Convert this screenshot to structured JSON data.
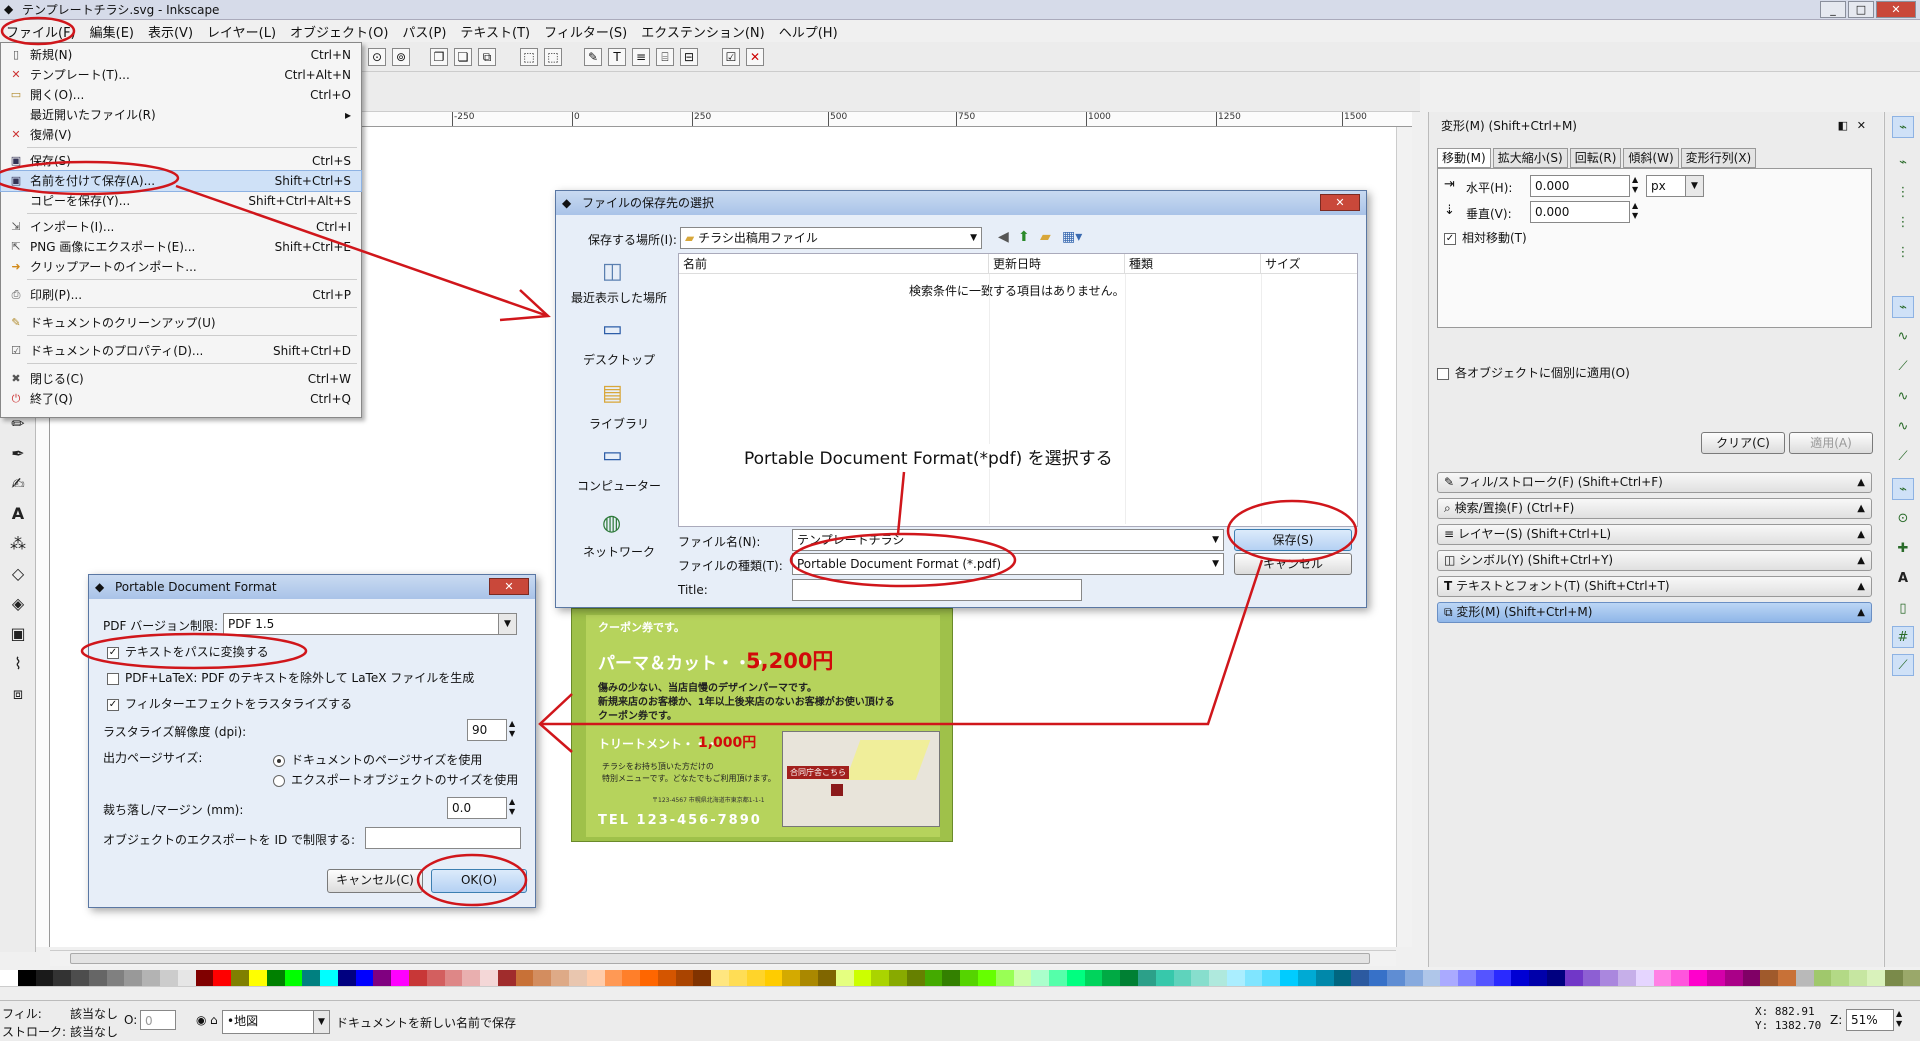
{
  "window": {
    "title": "テンプレートチラシ.svg - Inkscape",
    "min": "_",
    "max": "□",
    "close": "✕"
  },
  "menubar": [
    "ファイル(F)",
    "編集(E)",
    "表示(V)",
    "レイヤー(L)",
    "オブジェクト(O)",
    "パス(P)",
    "テキスト(T)",
    "フィルター(S)",
    "エクステンション(N)",
    "ヘルプ(H)"
  ],
  "file_menu": [
    {
      "label": "新規(N)",
      "shortcut": "Ctrl+N",
      "icon": "new-doc-icon"
    },
    {
      "label": "テンプレート(T)...",
      "shortcut": "Ctrl+Alt+N",
      "icon": "template-icon"
    },
    {
      "label": "開く(O)...",
      "shortcut": "Ctrl+O",
      "icon": "open-folder-icon"
    },
    {
      "label": "最近開いたファイル(R)",
      "shortcut": "▸",
      "icon": ""
    },
    {
      "label": "復帰(V)",
      "shortcut": "",
      "icon": "revert-icon"
    },
    {
      "label": "保存(S)",
      "shortcut": "Ctrl+S",
      "icon": "save-icon"
    },
    {
      "label": "名前を付けて保存(A)...",
      "shortcut": "Shift+Ctrl+S",
      "icon": "save-as-icon"
    },
    {
      "label": "コピーを保存(Y)...",
      "shortcut": "Shift+Ctrl+Alt+S",
      "icon": ""
    },
    {
      "label": "インポート(I)...",
      "shortcut": "Ctrl+I",
      "icon": "import-icon"
    },
    {
      "label": "PNG 画像にエクスポート(E)...",
      "shortcut": "Shift+Ctrl+E",
      "icon": "export-png-icon"
    },
    {
      "label": "クリップアートのインポート...",
      "shortcut": "",
      "icon": "clipart-icon"
    },
    {
      "label": "印刷(P)...",
      "shortcut": "Ctrl+P",
      "icon": "print-icon"
    },
    {
      "label": "ドキュメントのクリーンアップ(U)",
      "shortcut": "",
      "icon": "cleanup-icon"
    },
    {
      "label": "ドキュメントのプロパティ(D)...",
      "shortcut": "Shift+Ctrl+D",
      "icon": "doc-properties-icon"
    },
    {
      "label": "閉じる(C)",
      "shortcut": "Ctrl+W",
      "icon": "close-doc-icon"
    },
    {
      "label": "終了(Q)",
      "shortcut": "Ctrl+Q",
      "icon": "quit-icon"
    }
  ],
  "ruler_ticks": [
    "-250",
    "0",
    "250",
    "500",
    "750",
    "1000",
    "1250",
    "1500"
  ],
  "transform_panel": {
    "header": "変形(M) (Shift+Ctrl+M)",
    "tabs": [
      "移動(M)",
      "拡大縮小(S)",
      "回転(R)",
      "傾斜(W)",
      "変形行列(X)"
    ],
    "horizontal_label": "水平(H):",
    "horizontal_value": "0.000",
    "vertical_label": "垂直(V):",
    "vertical_value": "0.000",
    "unit": "px",
    "relative_move": "相対移動(T)",
    "apply_each": "各オブジェクトに個別に適用(O)",
    "clear": "クリア(C)",
    "apply": "適用(A)"
  },
  "docks": [
    "フィル/ストローク(F) (Shift+Ctrl+F)",
    "検索/置換(F) (Ctrl+F)",
    "レイヤー(S) (Shift+Ctrl+L)",
    "シンボル(Y) (Shift+Ctrl+Y)",
    "テキストとフォント(T) (Shift+Ctrl+T)",
    "変形(M) (Shift+Ctrl+M)"
  ],
  "save_dialog": {
    "title": "ファイルの保存先の選択",
    "location_label": "保存する場所(I):",
    "location_value": "チラシ出稿用ファイル",
    "places": [
      "最近表示した場所",
      "デスクトップ",
      "ライブラリ",
      "コンピューター",
      "ネットワーク"
    ],
    "columns": [
      "名前",
      "更新日時",
      "種類",
      "サイズ"
    ],
    "empty_message": "検索条件に一致する項目はありません。",
    "filename_label": "ファイル名(N):",
    "filename_value": "テンプレートチラシ",
    "filetype_label": "ファイルの種類(T):",
    "filetype_value": "Portable Document Format (*.pdf)",
    "title_label": "Title:",
    "save": "保存(S)",
    "cancel": "キャンセル"
  },
  "annotation": "Portable Document Format(*pdf) を選択する",
  "pdf_dialog": {
    "title": "Portable Document Format",
    "version_label": "PDF バージョン制限:",
    "version_value": "PDF 1.5",
    "text_to_path": "テキストをパスに変換する",
    "latex": "PDF+LaTeX: PDF のテキストを除外して LaTeX ファイルを生成",
    "rasterize": "フィルターエフェクトをラスタライズする",
    "dpi_label": "ラスタライズ解像度 (dpi):",
    "dpi_value": "90",
    "pagesize_label": "出力ページサイズ:",
    "opt_doc": "ドキュメントのページサイズを使用",
    "opt_obj": "エクスポートオブジェクトのサイズを使用",
    "bleed_label": "裁ち落し/マージン (mm):",
    "bleed_value": "0.0",
    "id_label": "オブジェクトのエクスポートを ID で制限する:",
    "cancel": "キャンセル(C)",
    "ok": "OK(O)"
  },
  "flyer": {
    "coupon": "クーポン券です。",
    "perm_title": "パーマ＆カット・・・",
    "perm_price": "5,200円",
    "perm_text1": "傷みの少ない、当店自慢のデザインパーマです。",
    "perm_text2": "新規来店のお客様か、1年以上後来店のないお客様がお使い頂ける",
    "perm_text3": "クーポン券です。",
    "treat_title": "トリートメント・・・",
    "treat_price": "1,000円",
    "treat_text1": "チラシをお持ち頂いた方だけの",
    "treat_text2": "特別メニューです。どなたでもご利用頂けます。",
    "map_label": "合同庁舎こちら",
    "address": "〒123-4567 市幌県北海道市東京都1-1-1",
    "tel": "TEL 123-456-7890"
  },
  "status": {
    "fill_label": "フィル:",
    "fill_value": "該当なし",
    "stroke_label": "ストローク:",
    "stroke_value": "該当なし",
    "opacity_label": "O:",
    "opacity_value": "0",
    "layer": "•地図",
    "message": "ドキュメントを新しい名前で保存",
    "x": "X: 882.91",
    "y": "Y: 1382.70",
    "zoom_label": "Z:",
    "zoom": "51%"
  },
  "colors": {
    "annotation_red": "#d0161b",
    "highlight": "#cfe1f7",
    "flyer_green": "#9fc14a",
    "price_red": "#d10a0a"
  }
}
